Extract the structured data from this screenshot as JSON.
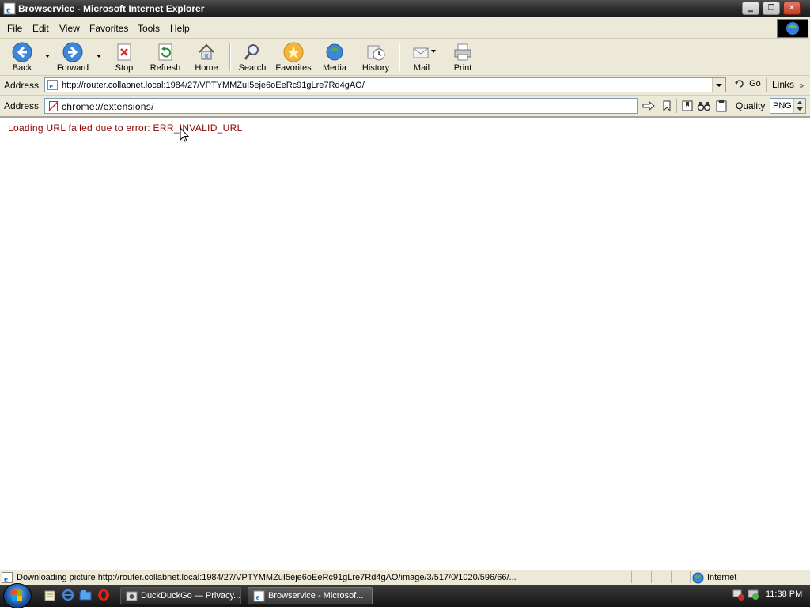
{
  "window": {
    "title": "Browservice - Microsoft Internet Explorer",
    "buttons": {
      "minimize": "‗",
      "restore": "❐",
      "close": "✕"
    }
  },
  "menubar": {
    "items": [
      "File",
      "Edit",
      "View",
      "Favorites",
      "Tools",
      "Help"
    ]
  },
  "toolbar": {
    "back": "Back",
    "forward": "Forward",
    "stop": "Stop",
    "refresh": "Refresh",
    "home": "Home",
    "search": "Search",
    "favorites": "Favorites",
    "media": "Media",
    "history": "History",
    "mail": "Mail",
    "print": "Print"
  },
  "address_bar": {
    "label": "Address",
    "url": "http://router.collabnet.local:1984/27/VPTYMMZuI5eje6oEeRc91gLre7Rd4gAO/",
    "go": "Go",
    "links": "Links"
  },
  "browservice_bar": {
    "label": "Address",
    "url": "chrome://extensions/",
    "quality_label": "Quality",
    "quality_value": "PNG"
  },
  "content": {
    "error": "Loading URL failed due to error: ERR_INVALID_URL"
  },
  "statusbar": {
    "text": "Downloading picture http://router.collabnet.local:1984/27/VPTYMMZuI5eje6oEeRc91gLre7Rd4gAO/image/3/517/0/1020/596/66/...",
    "zone": "Internet"
  },
  "taskbar": {
    "tasks": [
      {
        "label": "DuckDuckGo — Privacy..."
      },
      {
        "label": "Browservice - Microsof..."
      }
    ],
    "clock": "11:38 PM"
  },
  "colors": {
    "error_text": "#8b0000",
    "chrome_bg": "#ece9d8",
    "titlebar": "#2d2d2d"
  }
}
